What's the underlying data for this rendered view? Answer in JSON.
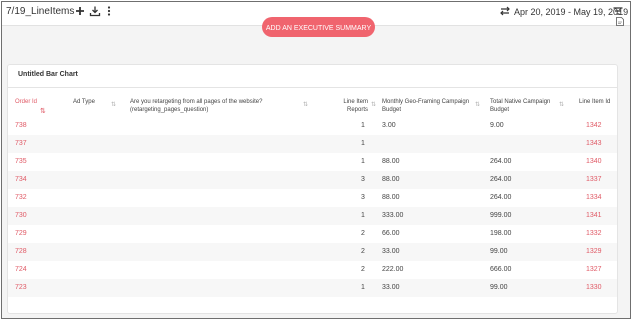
{
  "app": {
    "title": "7/19_LineItems",
    "date_range": "Apr 20, 2019 - May 19, 2019",
    "icons": [
      "plus-icon",
      "download-icon",
      "kebab-icon",
      "swap-icon",
      "filter-icon",
      "pdf-icon"
    ]
  },
  "buttons": {
    "executive_summary": "ADD AN EXECUTIVE SUMMARY"
  },
  "card": {
    "title": "Untitled Bar Chart"
  },
  "table": {
    "headers": {
      "order_id": "Order Id",
      "ad_type": "Ad Type",
      "retargeting": "Are you retargeting from all pages of the website? (retargeting_pages_question)",
      "reports": "Line Item Reports",
      "geo_budget": "Monthly Geo-Framing Campaign Budget",
      "native_budget": "Total Native Campaign Budget",
      "line_item_id": "Line Item Id"
    },
    "active_sort": "order_id",
    "accent_color": "#e05a66",
    "rows": [
      {
        "order_id": "738",
        "reports": "1",
        "geo_budget": "3.00",
        "native_budget": "9.00",
        "line_item_id": "1342"
      },
      {
        "order_id": "737",
        "reports": "1",
        "geo_budget": "",
        "native_budget": "",
        "line_item_id": "1343"
      },
      {
        "order_id": "735",
        "reports": "1",
        "geo_budget": "88.00",
        "native_budget": "264.00",
        "line_item_id": "1340"
      },
      {
        "order_id": "734",
        "reports": "3",
        "geo_budget": "88.00",
        "native_budget": "264.00",
        "line_item_id": "1337"
      },
      {
        "order_id": "732",
        "reports": "3",
        "geo_budget": "88.00",
        "native_budget": "264.00",
        "line_item_id": "1334"
      },
      {
        "order_id": "730",
        "reports": "1",
        "geo_budget": "333.00",
        "native_budget": "999.00",
        "line_item_id": "1341"
      },
      {
        "order_id": "729",
        "reports": "2",
        "geo_budget": "66.00",
        "native_budget": "198.00",
        "line_item_id": "1332"
      },
      {
        "order_id": "728",
        "reports": "2",
        "geo_budget": "33.00",
        "native_budget": "99.00",
        "line_item_id": "1329"
      },
      {
        "order_id": "724",
        "reports": "2",
        "geo_budget": "222.00",
        "native_budget": "666.00",
        "line_item_id": "1327"
      },
      {
        "order_id": "723",
        "reports": "1",
        "geo_budget": "33.00",
        "native_budget": "99.00",
        "line_item_id": "1330"
      }
    ]
  }
}
